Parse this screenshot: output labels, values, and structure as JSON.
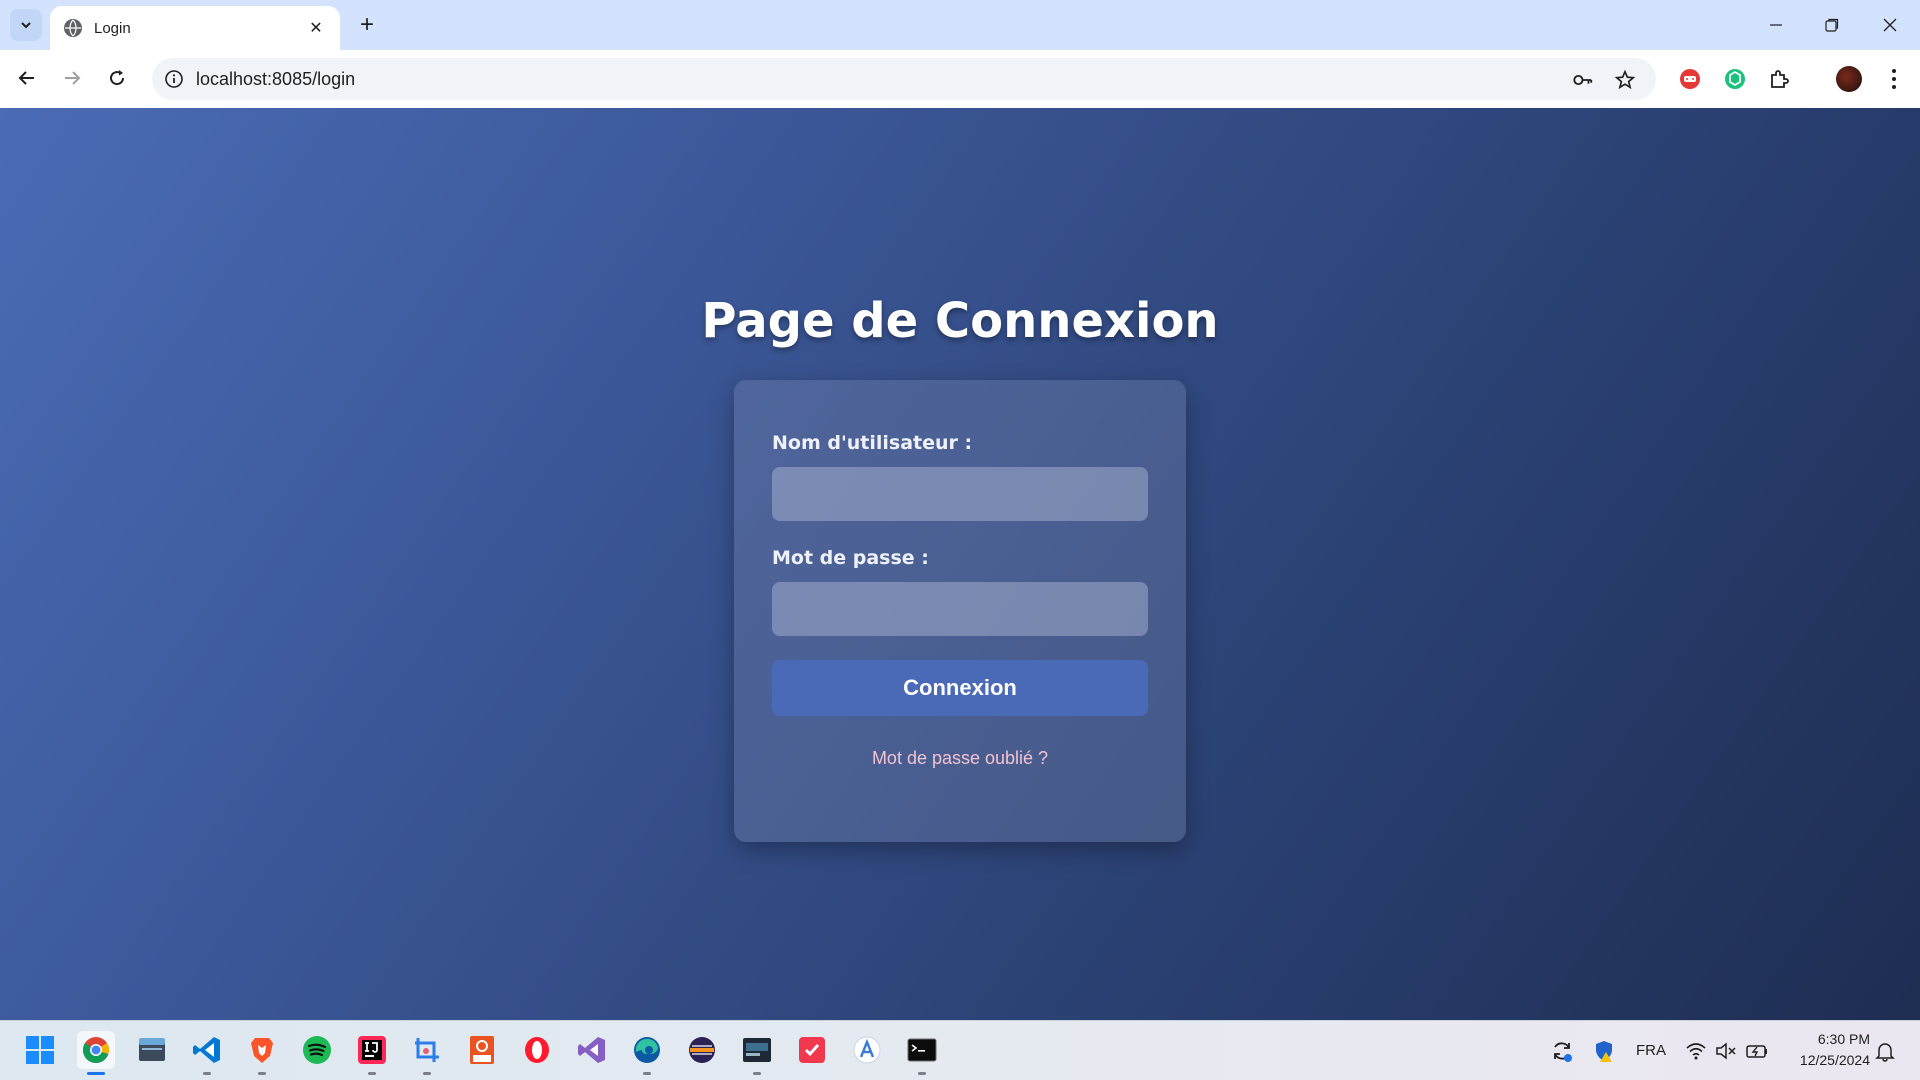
{
  "browser": {
    "tab_title": "Login",
    "url": "localhost:8085/login"
  },
  "page": {
    "title": "Page de Connexion",
    "username_label": "Nom d'utilisateur :",
    "username_value": "",
    "password_label": "Mot de passe :",
    "password_value": "",
    "submit_label": "Connexion",
    "forgot_link": "Mot de passe oublié ?"
  },
  "taskbar": {
    "apps": [
      "start-icon",
      "chrome-icon",
      "file-explorer-icon",
      "vscode-icon",
      "brave-icon",
      "spotify-icon",
      "intellij-icon",
      "snipping-tool-icon",
      "ubuntu-icon",
      "opera-icon",
      "visual-studio-icon",
      "edge-icon",
      "eclipse-icon",
      "mysql-workbench-icon",
      "calendar-app-icon",
      "translate-app-icon",
      "terminal-icon"
    ],
    "language": "FRA",
    "time": "6:30 PM",
    "date": "12/25/2024"
  },
  "colors": {
    "accent_button": "#4a6ab8",
    "forgot_link": "#f3c2d2",
    "background_start": "#4a6bb5",
    "background_end": "#1e2d52"
  }
}
